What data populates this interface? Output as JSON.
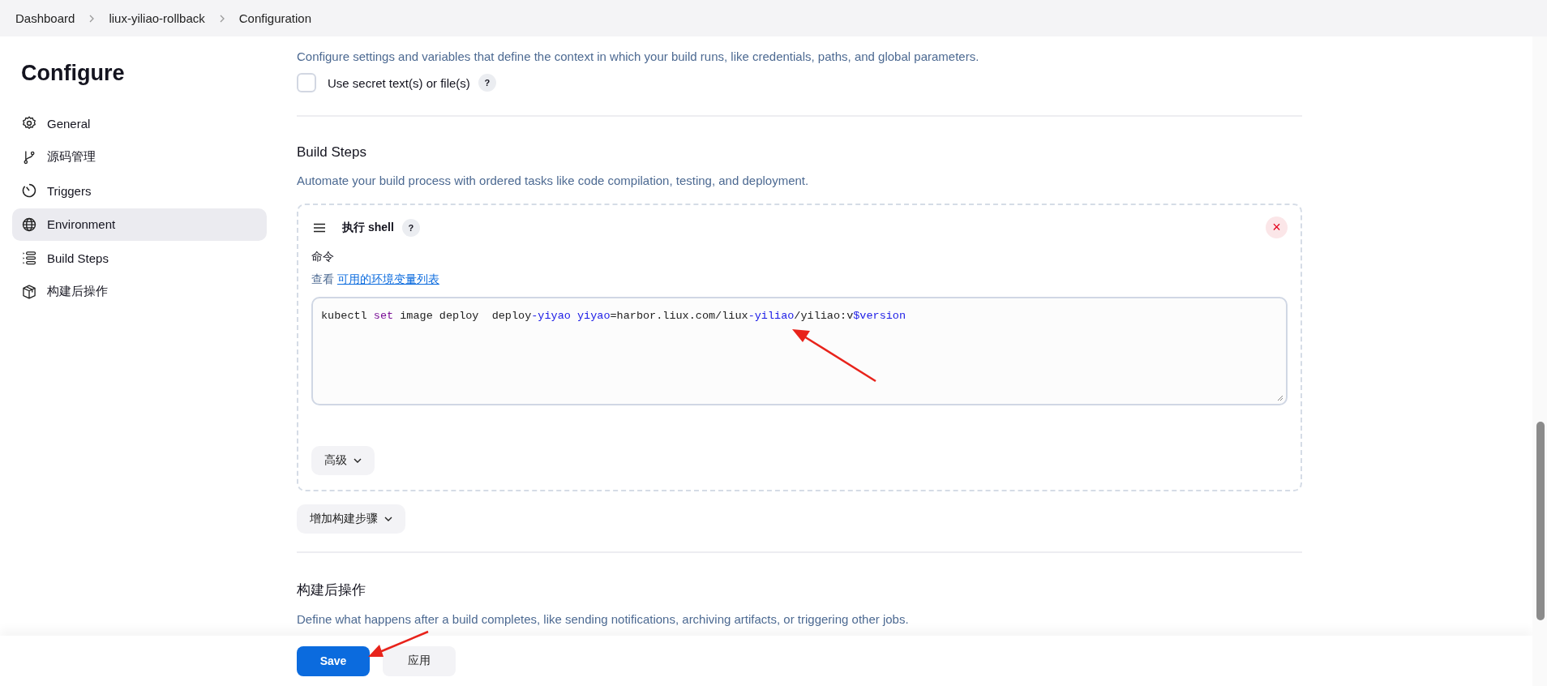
{
  "breadcrumbs": [
    "Dashboard",
    "liux-yiliao-rollback",
    "Configuration"
  ],
  "sidebar": {
    "title": "Configure",
    "items": [
      {
        "label": "General",
        "kind": "gear",
        "selected": false
      },
      {
        "label": "源码管理",
        "kind": "branch",
        "selected": false
      },
      {
        "label": "Triggers",
        "kind": "timer",
        "selected": false
      },
      {
        "label": "Environment",
        "kind": "globe",
        "selected": true
      },
      {
        "label": "Build Steps",
        "kind": "list",
        "selected": false
      },
      {
        "label": "构建后操作",
        "kind": "package",
        "selected": false
      }
    ]
  },
  "environment": {
    "description": "Configure settings and variables that define the context in which your build runs, like credentials, paths, and global parameters.",
    "options": [
      {
        "label": "Use secret text(s) or file(s)",
        "checked": false,
        "help": "?"
      }
    ]
  },
  "build_steps": {
    "title": "Build Steps",
    "description": "Automate your build process with ordered tasks like code compilation, testing, and deployment.",
    "steps": [
      {
        "title": "执行 shell",
        "help": "?",
        "close": "×",
        "field_label": "命令",
        "hint_prefix": "查看",
        "hint_link": "可用的环境变量列表",
        "command": [
          {
            "text": "kubectl ",
            "kind": "plain"
          },
          {
            "text": "set",
            "kind": "keyword"
          },
          {
            "text": " image deploy  deploy",
            "kind": "plain"
          },
          {
            "text": "-yiyao yiyao",
            "kind": "ident"
          },
          {
            "text": "=harbor.liux.com/liux",
            "kind": "plain"
          },
          {
            "text": "-yiliao",
            "kind": "ident"
          },
          {
            "text": "/yiliao:v",
            "kind": "plain"
          },
          {
            "text": "$version",
            "kind": "ident"
          }
        ],
        "advanced": "高级"
      }
    ],
    "add_button": "增加构建步骤"
  },
  "post_build": {
    "title": "构建后操作",
    "description": "Define what happens after a build completes, like sending notifications, archiving artifacts, or triggering other jobs."
  },
  "footer": {
    "save": "Save",
    "apply": "应用"
  }
}
